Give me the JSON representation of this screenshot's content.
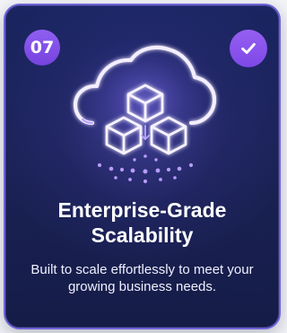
{
  "card": {
    "number": "07",
    "title_line1": "Enterprise-Grade",
    "title_line2": "Scalability",
    "description": "Built to scale effortlessly to meet your growing business needs."
  },
  "icons": {
    "badge": "check-icon",
    "illustration": "cloud-cubes-icon"
  },
  "colors": {
    "card_background": "#1a2561",
    "accent_purple": "#7e48e8",
    "text_primary": "#ffffff"
  }
}
